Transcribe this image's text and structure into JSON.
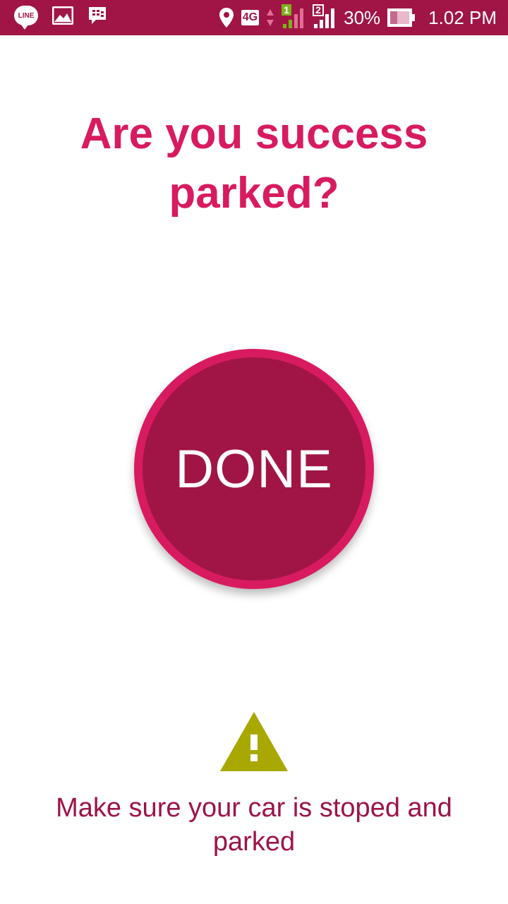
{
  "status_bar": {
    "left_icons": [
      "line-app-icon",
      "gallery-icon",
      "blackberry-messenger-icon"
    ],
    "line_label": "LINE",
    "network_type": "4G",
    "sim1": "1",
    "sim2": "2",
    "battery_percent": "30%",
    "time": "1.02 PM"
  },
  "main": {
    "title": "Are you success parked?",
    "done_label": "DONE",
    "warning_icon": "warning-triangle-icon",
    "notice": "Make sure your car is stoped and parked"
  },
  "colors": {
    "status_bar": "#a01545",
    "accent": "#d81b60",
    "button_fill": "#a01545",
    "warning": "#a8a800",
    "notice_text": "#9c1448"
  }
}
